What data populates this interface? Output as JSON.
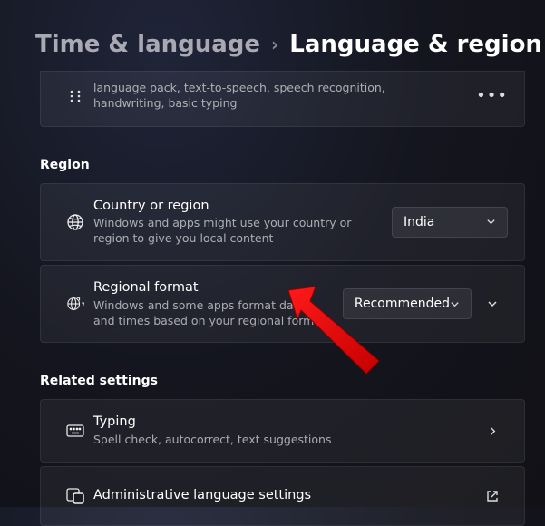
{
  "breadcrumb": {
    "parent": "Time & language",
    "current": "Language & region"
  },
  "language_card": {
    "desc": "language pack, text-to-speech, speech recognition, handwriting, basic typing"
  },
  "sections": {
    "region_header": "Region",
    "related_header": "Related settings"
  },
  "country": {
    "title": "Country or region",
    "desc": "Windows and apps might use your country or region to give you local content",
    "value": "India"
  },
  "regional_format": {
    "title": "Regional format",
    "desc": "Windows and some apps format dates and times based on your regional format",
    "value": "Recommended"
  },
  "typing": {
    "title": "Typing",
    "desc": "Spell check, autocorrect, text suggestions"
  },
  "admin": {
    "title": "Administrative language settings"
  }
}
